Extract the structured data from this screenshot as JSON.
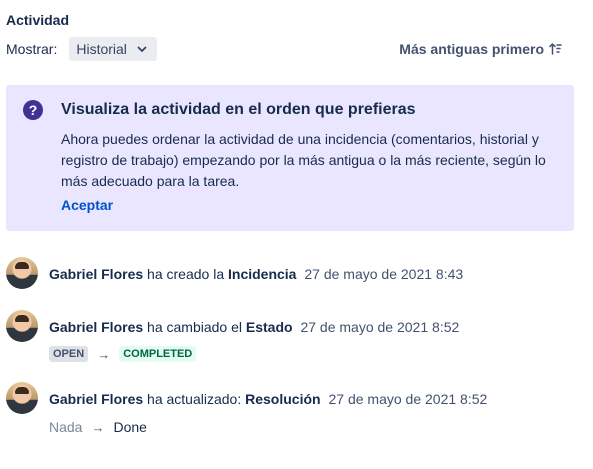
{
  "section_title": "Actividad",
  "show": {
    "label": "Mostrar:",
    "selected": "Historial"
  },
  "sort": {
    "label": "Más antiguas primero"
  },
  "banner": {
    "title": "Visualiza la actividad en el orden que prefieras",
    "body": "Ahora puedes ordenar la actividad de una incidencia (comentarios, historial y registro de trabajo) empezando por la más antigua o la más reciente, según lo más adecuado para la tarea.",
    "action": "Aceptar"
  },
  "entries": [
    {
      "user": "Gabriel Flores",
      "action": "ha creado la",
      "field": "Incidencia",
      "date": "27 de mayo de 2021 8:43"
    },
    {
      "user": "Gabriel Flores",
      "action": "ha cambiado el",
      "field": "Estado",
      "date": "27 de mayo de 2021 8:52",
      "from": "OPEN",
      "to": "COMPLETED"
    },
    {
      "user": "Gabriel Flores",
      "action": "ha actualizado:",
      "field": "Resolución",
      "date": "27 de mayo de 2021 8:52",
      "from": "Nada",
      "to": "Done"
    }
  ],
  "colors": {
    "banner_bg": "#eae6ff",
    "link": "#0052cc",
    "completed_bg": "#e3fcef",
    "completed_text": "#006644"
  }
}
